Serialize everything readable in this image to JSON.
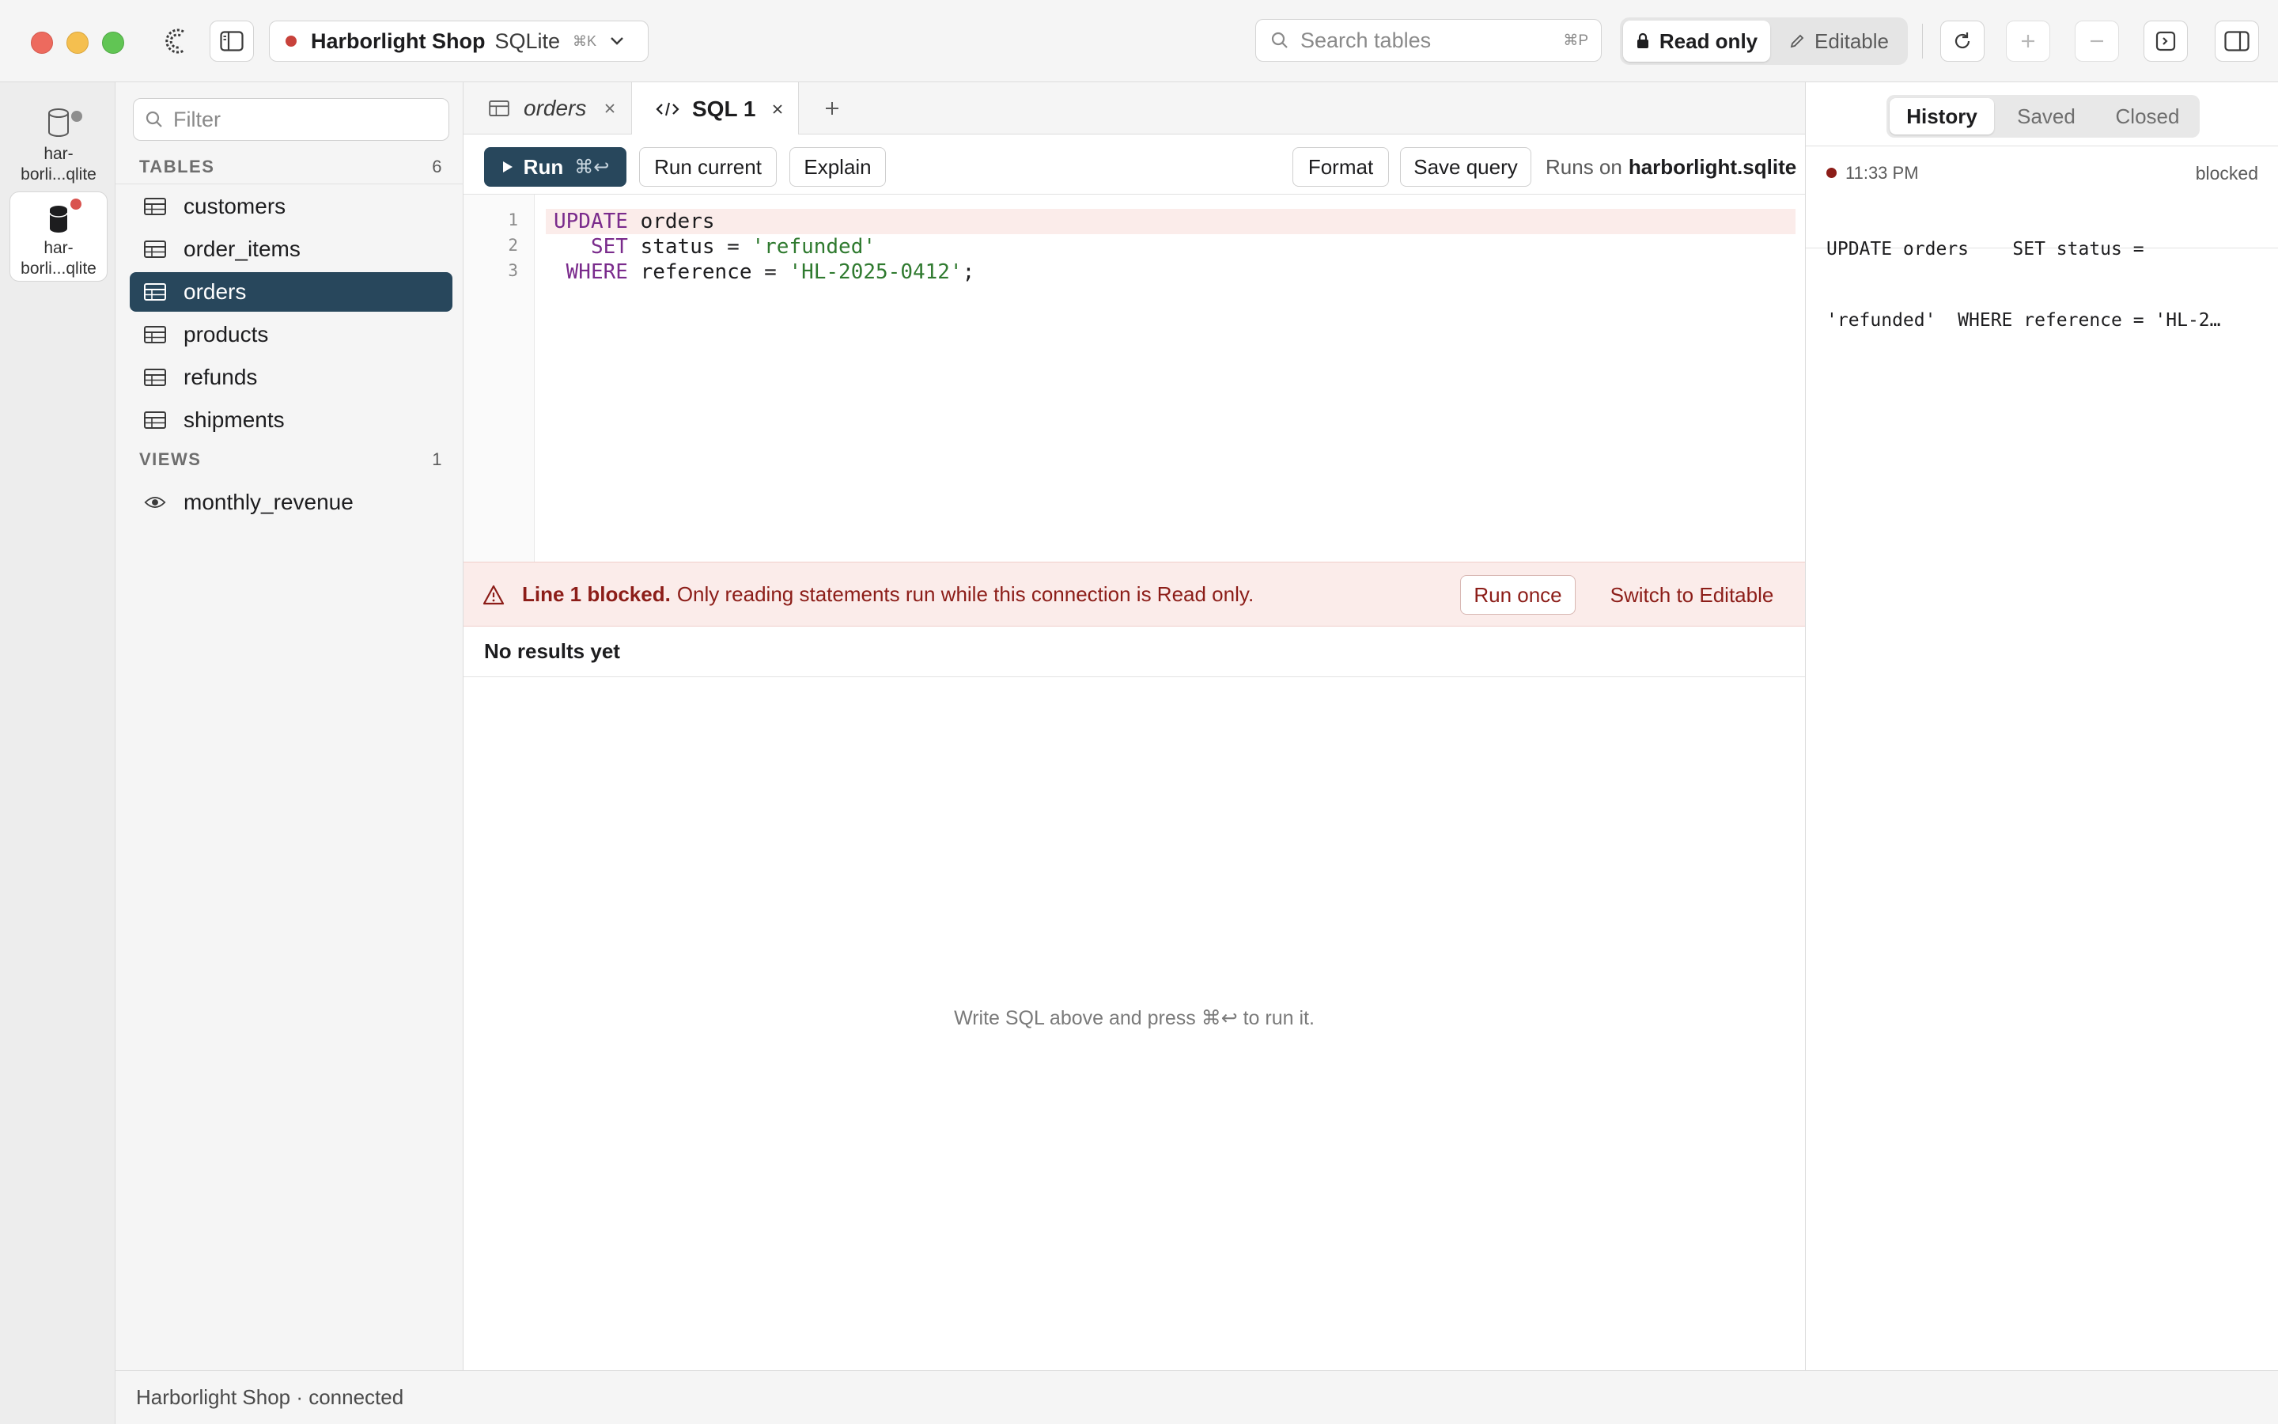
{
  "window": {
    "connection_name": "Harborlight Shop",
    "engine": "SQLite",
    "switch_shortcut": "⌘K",
    "status_color": "#c8423b"
  },
  "search": {
    "placeholder": "Search tables",
    "shortcut": "⌘P"
  },
  "mode": {
    "read_only": "Read only",
    "editable": "Editable",
    "selected": "Read only"
  },
  "rail": {
    "items": [
      {
        "label": "har-\nborli...qlite",
        "icon": "database-icon",
        "badge_color": "#8e8e8e"
      },
      {
        "label": "har-\nborli...qlite",
        "icon": "database-icon",
        "badge_color": "#d9534f",
        "active": true
      }
    ]
  },
  "sidebar": {
    "filter_placeholder": "Filter",
    "tables_header": "TABLES",
    "tables_count": "6",
    "tables": [
      "customers",
      "order_items",
      "orders",
      "products",
      "refunds",
      "shipments"
    ],
    "selected_table": "orders",
    "views_header": "VIEWS",
    "views_count": "1",
    "views": [
      "monthly_revenue"
    ]
  },
  "tabs": [
    {
      "label": "orders",
      "icon": "table-icon",
      "italic": true
    },
    {
      "label": "SQL 1",
      "icon": "code-icon",
      "active": true
    }
  ],
  "toolbar": {
    "run": "Run",
    "run_shortcut": "⌘↩",
    "run_current": "Run current",
    "explain": "Explain",
    "format": "Format",
    "save_query": "Save query",
    "runs_on_prefix": "Runs on",
    "runs_on_target": "harborlight.sqlite"
  },
  "editor": {
    "line_numbers": [
      "1",
      "2",
      "3"
    ],
    "lines": [
      {
        "kw": "UPDATE",
        "rest": " orders"
      },
      {
        "indent": "   ",
        "kw": "SET",
        "rest": " status = ",
        "str": "'refunded'"
      },
      {
        "indent": " ",
        "kw": "WHERE",
        "rest": " reference = ",
        "str": "'HL-2025-0412'",
        "tail": ";"
      }
    ]
  },
  "banner": {
    "title": "Line 1 blocked.",
    "message": "Only reading statements run while this connection is Read only.",
    "run_once": "Run once",
    "switch_editable": "Switch to Editable"
  },
  "results": {
    "header": "No results yet",
    "empty_hint": "Write SQL above and press ⌘↩ to run it."
  },
  "history_panel": {
    "tabs": [
      "History",
      "Saved",
      "Closed"
    ],
    "active_tab": "History",
    "entries": [
      {
        "time": "11:33 PM",
        "status": "blocked",
        "line1": "UPDATE orders    SET status =",
        "line2": "'refunded'  WHERE reference = 'HL-2…"
      }
    ]
  },
  "statusbar": {
    "text": "Harborlight Shop · connected"
  }
}
